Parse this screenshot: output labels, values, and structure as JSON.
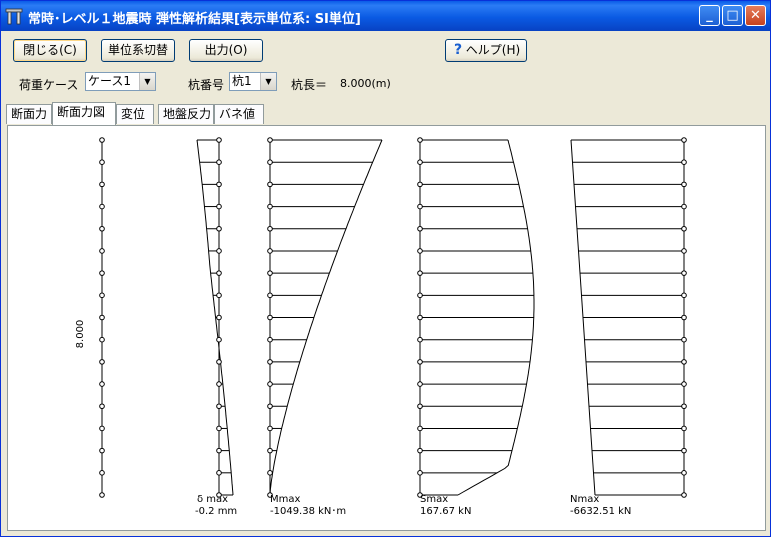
{
  "window": {
    "title": "常時･レベル１地震時  弾性解析結果[表示単位系: SI単位]",
    "minimize_label": "_",
    "maximize_label": "□",
    "close_label": "✕"
  },
  "toolbar": {
    "close_label": "閉じる(C)",
    "units_label": "単位系切替",
    "output_label": "出力(O)",
    "help_label": "ヘルプ(H)"
  },
  "selectors": {
    "load_case_label": "荷重ケース",
    "load_case_value": "ケース1",
    "pile_no_label": "杭番号",
    "pile_no_value": "杭1",
    "pile_length_label": "杭長＝",
    "pile_length_value": "8.000(m)"
  },
  "tabs": [
    "断面力",
    "断面力図",
    "変位",
    "地盤反力",
    "バネ値"
  ],
  "active_tab": "断面力図",
  "diagram": {
    "length_label": "8.000",
    "node_count": 17,
    "deflection": {
      "name": "δ max",
      "value": "-0.2 mm"
    },
    "moment": {
      "name": "Mmax",
      "value": "-1049.38 kN･m"
    },
    "shear": {
      "name": "Smax",
      "value": "167.67 kN"
    },
    "axial": {
      "name": "Nmax",
      "value": "-6632.51 kN"
    }
  }
}
